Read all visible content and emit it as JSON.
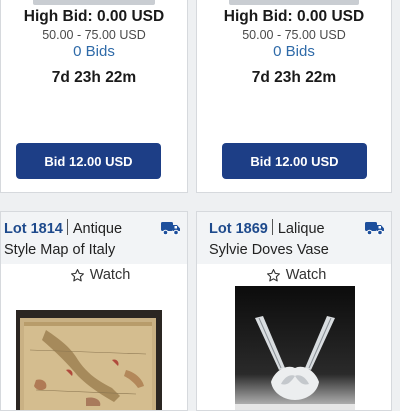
{
  "lots": [
    {
      "high_bid": "High Bid: 0.00 USD",
      "range": "50.00 - 75.00 USD",
      "bids": "0 Bids",
      "timer": "7d 23h 22m",
      "bid_button": "Bid 12.00 USD"
    },
    {
      "high_bid": "High Bid: 0.00 USD",
      "range": "50.00 - 75.00 USD",
      "bids": "0 Bids",
      "timer": "7d 23h 22m",
      "bid_button": "Bid 12.00 USD"
    }
  ],
  "listings": [
    {
      "lot_number": "Lot 1814",
      "title_part1": "Antique",
      "title_part2": "Style Map of Italy",
      "watch_label": "Watch",
      "icons": {
        "shipping": "truck-icon",
        "watch": "star-outline-icon"
      },
      "image": "map-of-italy-photo"
    },
    {
      "lot_number": "Lot 1869",
      "title_part1": "Lalique",
      "title_part2": "Sylvie Doves Vase",
      "watch_label": "Watch",
      "icons": {
        "shipping": "truck-icon",
        "watch": "star-outline-icon"
      },
      "image": "lalique-doves-vase-photo"
    }
  ],
  "colors": {
    "bid_button": "#1d3e86",
    "lot_number": "#1e4a8c",
    "bids_link": "#2e6aa8",
    "truck_icon": "#1d4f9c"
  }
}
